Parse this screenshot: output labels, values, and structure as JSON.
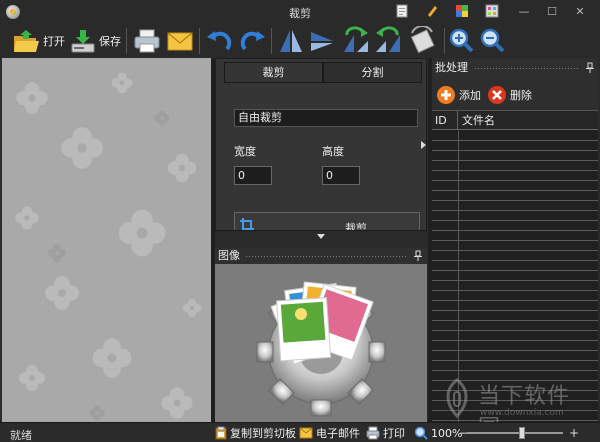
{
  "window": {
    "title": "裁剪",
    "minimize_glyph": "—",
    "maximize_glyph": "☐",
    "close_glyph": "✕"
  },
  "toolbar": {
    "open_label": "打开",
    "save_label": "保存"
  },
  "crop_panel": {
    "tabs": [
      {
        "label": "裁剪",
        "active": true
      },
      {
        "label": "分割",
        "active": false
      }
    ],
    "mode_value": "自由裁剪",
    "width_label": "宽度",
    "height_label": "高度",
    "width_value": "0",
    "height_value": "0",
    "crop_button_label": "裁剪"
  },
  "image_panel": {
    "title": "图像"
  },
  "batch_panel": {
    "title": "批处理",
    "add_label": "添加",
    "delete_label": "删除",
    "columns": [
      "ID",
      "文件名"
    ]
  },
  "statusbar": {
    "status": "就绪",
    "copy_label": "复制到剪切板",
    "email_label": "电子邮件",
    "print_label": "打印",
    "zoom_value": "100%",
    "zoom_minus": "−",
    "zoom_plus": "+"
  },
  "watermark": {
    "text": "当下软件园",
    "url": "www.downxia.com"
  },
  "colors": {
    "background": "#2b2b2b",
    "preview_bg": "#a9a9a9",
    "add_icon": "#f07a1e",
    "delete_icon": "#d9381e",
    "blue_arrow": "#2f7fd8"
  }
}
